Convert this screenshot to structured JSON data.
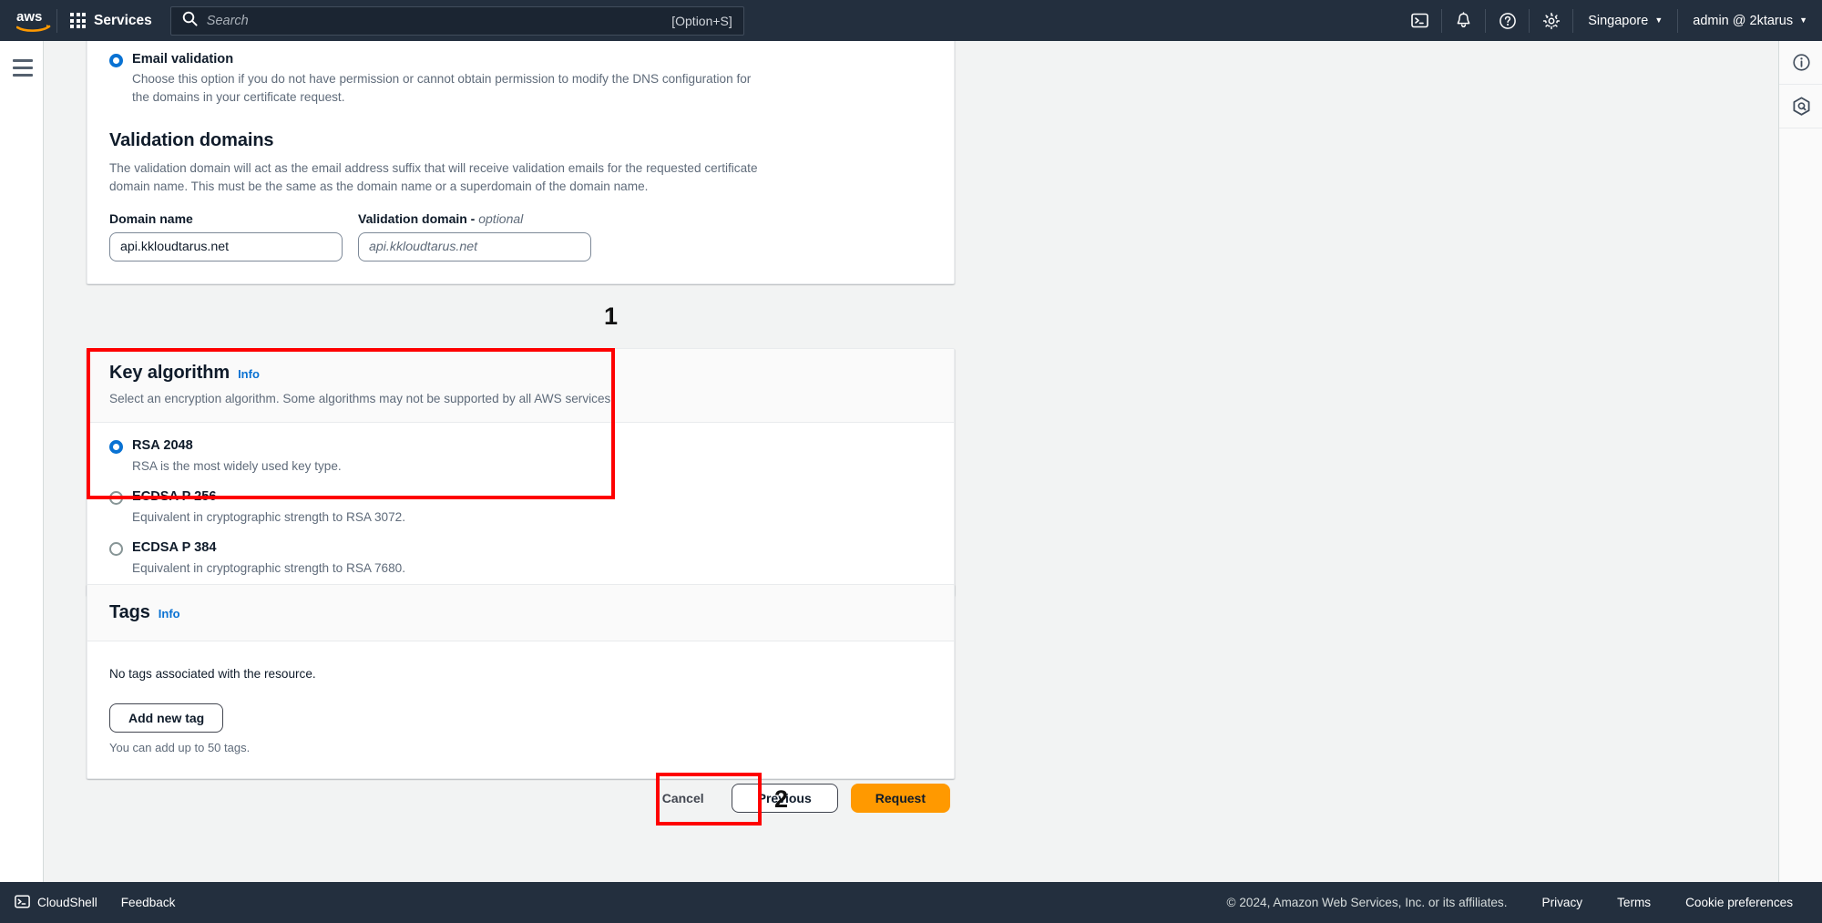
{
  "topnav": {
    "logo_alt": "aws",
    "services_label": "Services",
    "search_placeholder": "Search",
    "search_hint": "[Option+S]",
    "icons": [
      "cloudshell-icon",
      "bell-icon",
      "help-icon",
      "gear-icon"
    ],
    "region_label": "Singapore",
    "account_label": "admin @ 2ktarus"
  },
  "rightpanel": {
    "icons": [
      "info-circle-icon",
      "aws-q-hexagon-icon"
    ]
  },
  "validation": {
    "option_label": "Email validation",
    "option_desc": "Choose this option if you do not have permission or cannot obtain permission to modify the DNS configuration for the domains in your certificate request.",
    "section_title": "Validation domains",
    "section_desc": "The validation domain will act as the email address suffix that will receive validation emails for the requested certificate domain name. This must be the same as the domain name or a superdomain of the domain name.",
    "domain_name_label": "Domain name",
    "validation_domain_label": "Validation domain - ",
    "validation_domain_optional": "optional",
    "domain_name_value": "api.kkloudtarus.net",
    "validation_domain_placeholder": "api.kkloudtarus.net"
  },
  "key_algorithm": {
    "title": "Key algorithm",
    "info_label": "Info",
    "description": "Select an encryption algorithm. Some algorithms may not be supported by all AWS services.",
    "options": [
      {
        "label": "RSA 2048",
        "desc": "RSA is the most widely used key type.",
        "selected": true
      },
      {
        "label": "ECDSA P 256",
        "desc": "Equivalent in cryptographic strength to RSA 3072.",
        "selected": false
      },
      {
        "label": "ECDSA P 384",
        "desc": "Equivalent in cryptographic strength to RSA 7680.",
        "selected": false
      }
    ]
  },
  "tags": {
    "title": "Tags",
    "info_label": "Info",
    "empty_text": "No tags associated with the resource.",
    "add_button": "Add new tag",
    "limit_note": "You can add up to 50 tags."
  },
  "actions": {
    "cancel": "Cancel",
    "previous": "Previous",
    "request": "Request"
  },
  "annotations": {
    "one": "1",
    "two": "2",
    "color": "#fe0000"
  },
  "bottombar": {
    "cloudshell": "CloudShell",
    "feedback": "Feedback",
    "copyright": "© 2024, Amazon Web Services, Inc. or its affiliates.",
    "privacy": "Privacy",
    "terms": "Terms",
    "cookies": "Cookie preferences"
  }
}
